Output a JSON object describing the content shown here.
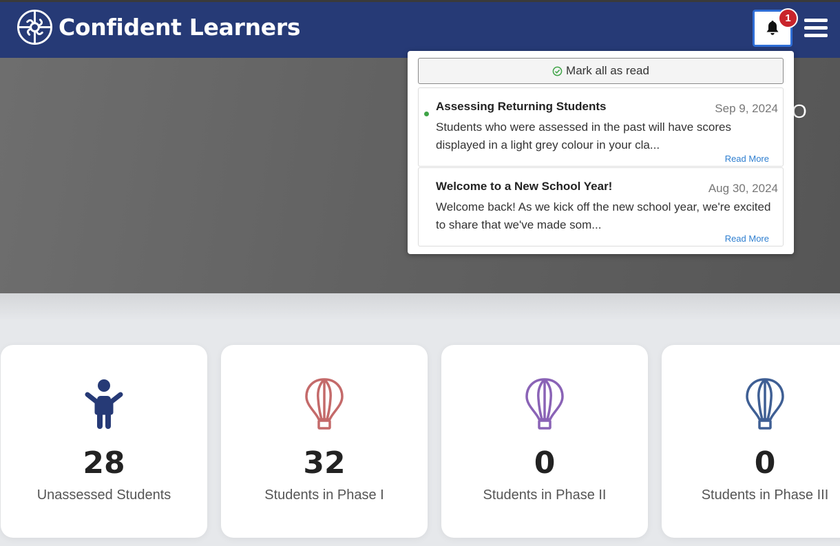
{
  "header": {
    "brand_name": "Confident Learners",
    "logo_icon": "logo-icon",
    "notification_count": "1",
    "bell_icon": "bell-icon",
    "menu_icon": "hamburger-menu-icon"
  },
  "hero": {
    "partial_text": "O"
  },
  "notifications": {
    "mark_all_label": "Mark all as read",
    "items": [
      {
        "title": "Assessing Returning Students",
        "date": "Sep 9, 2024",
        "body": "Students who were assessed in the past will have scores displayed in a light grey colour in your cla...",
        "read_more": "Read More",
        "unread": true
      },
      {
        "title": "Welcome to a New School Year!",
        "date": "Aug 30, 2024",
        "body": "Welcome back! As we kick off the new school year, we're excited to share that we've made som...",
        "read_more": "Read More",
        "unread": false
      }
    ]
  },
  "stats": [
    {
      "value": "28",
      "label": "Unassessed Students",
      "icon": "person-icon",
      "color": "#263a76"
    },
    {
      "value": "32",
      "label": "Students in Phase I",
      "icon": "hot-air-balloon-icon",
      "color": "#c46a6a"
    },
    {
      "value": "0",
      "label": "Students in Phase II",
      "icon": "hot-air-balloon-icon",
      "color": "#8a63b6"
    },
    {
      "value": "0",
      "label": "Students in Phase III",
      "icon": "hot-air-balloon-icon",
      "color": "#3f5f94"
    }
  ],
  "colors": {
    "header_bg": "#263a76",
    "badge": "#c9242b",
    "link": "#2f7fd0",
    "unread_dot": "#3fa447"
  }
}
